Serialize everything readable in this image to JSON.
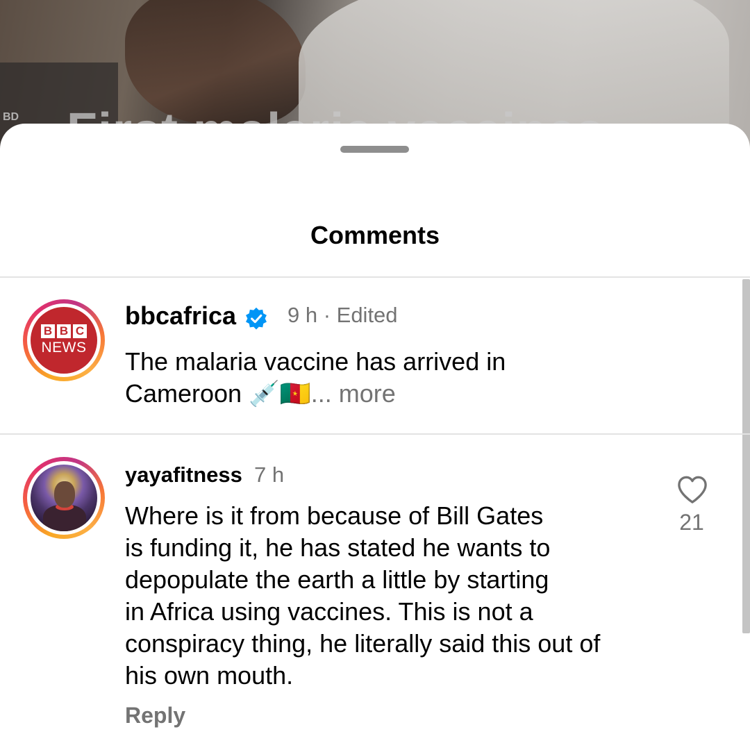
{
  "background": {
    "logo_text": "BD",
    "headline": "First malaria vaccines"
  },
  "sheet": {
    "title": "Comments"
  },
  "caption": {
    "username": "bbcafrica",
    "avatar_blocks": [
      "B",
      "B",
      "C"
    ],
    "avatar_word": "NEWS",
    "verified_icon": "verified-badge-icon",
    "time": "9 h · Edited",
    "text_line1": "The malaria vaccine has arrived in",
    "text_line2": "Cameroon 💉🇨🇲",
    "more_label": "... more"
  },
  "comments": [
    {
      "username": "yayafitness",
      "time": "7 h",
      "lines": [
        "Where is it from because of Bill Gates",
        "is funding it, he has stated he wants to",
        "depopulate the earth a little by starting",
        "in Africa using vaccines. This is not a",
        "conspiracy thing, he literally said this out of",
        "his own mouth."
      ],
      "like_count": "21",
      "like_icon": "heart-outline-icon",
      "reply_label": "Reply"
    }
  ],
  "colors": {
    "text": "#000000",
    "secondary_text": "#737373",
    "verified_blue": "#0095f6",
    "bbc_red": "#c0272d",
    "divider": "#e3e3e3"
  }
}
